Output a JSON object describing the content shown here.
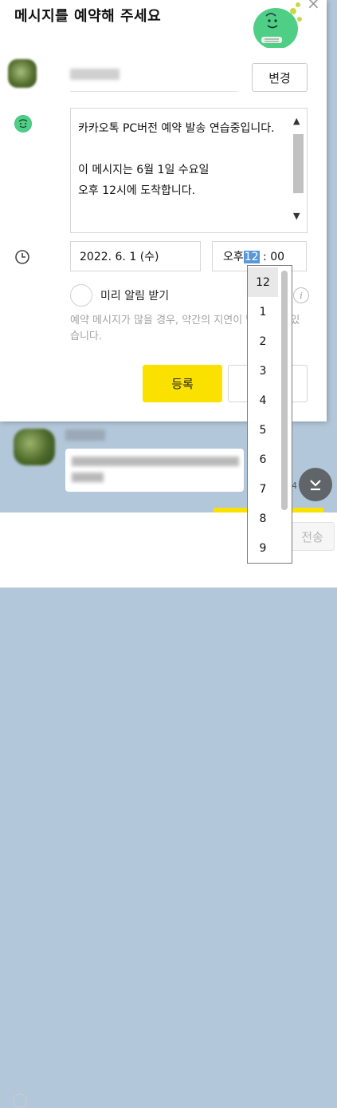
{
  "dialog": {
    "title": "메시지를 예약해 주세요",
    "change_label": "변경",
    "message": "카카오톡 PC버전 예약 발송 연습중입니다.\n\n이 메시지는 6월 1일 수요일\n오후 12시에 도착합니다.",
    "date": "2022. 6. 1 (수)",
    "time": {
      "period": "오후",
      "hour": "12",
      "separator": ":",
      "minute": "00"
    },
    "reminder_label": "미리 알림 받기",
    "notice": "예약 메시지가 많을 경우, 약간의 지연이 발생할 수 있습니다.",
    "register_label": "등록"
  },
  "hour_dropdown": {
    "selected": "12",
    "options": [
      "12",
      "1",
      "2",
      "3",
      "4",
      "5",
      "6",
      "7",
      "8",
      "9"
    ]
  },
  "chat": {
    "send_label": "전송",
    "time_fragment": "4"
  },
  "colors": {
    "accent_yellow": "#fae100",
    "chat_background": "#b2c7d9",
    "selection_blue": "#5897d8"
  }
}
